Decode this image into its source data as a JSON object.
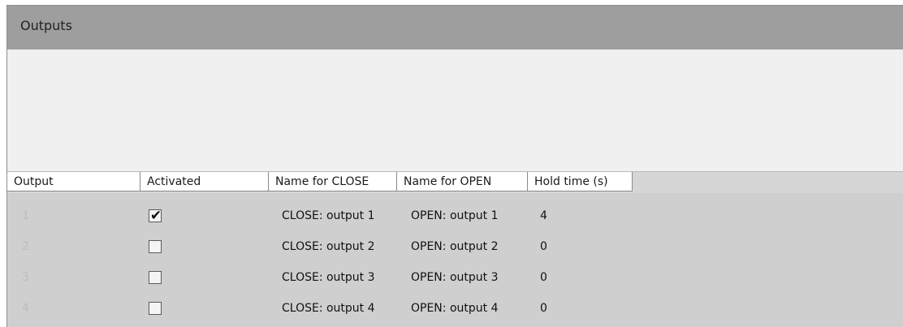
{
  "panel": {
    "title": "Outputs"
  },
  "grid": {
    "columns": [
      "Output",
      "Activated",
      "Name for CLOSE",
      "Name for OPEN",
      "Hold time (s)"
    ],
    "rows": [
      {
        "index": "1",
        "activated": true,
        "close_name": "CLOSE: output 1",
        "open_name": "OPEN: output 1",
        "hold_time": "4"
      },
      {
        "index": "2",
        "activated": false,
        "close_name": "CLOSE: output 2",
        "open_name": "OPEN: output 2",
        "hold_time": "0"
      },
      {
        "index": "3",
        "activated": false,
        "close_name": "CLOSE: output 3",
        "open_name": "OPEN: output 3",
        "hold_time": "0"
      },
      {
        "index": "4",
        "activated": false,
        "close_name": "CLOSE: output 4",
        "open_name": "OPEN: output 4",
        "hold_time": "0"
      }
    ]
  },
  "colors": {
    "header_bar": "#9e9e9e",
    "grid_background": "#cfcfcf",
    "panel_background": "#f0f0f0",
    "index_text": "#bdbdbd"
  },
  "icons": {
    "checked": "check-icon"
  }
}
